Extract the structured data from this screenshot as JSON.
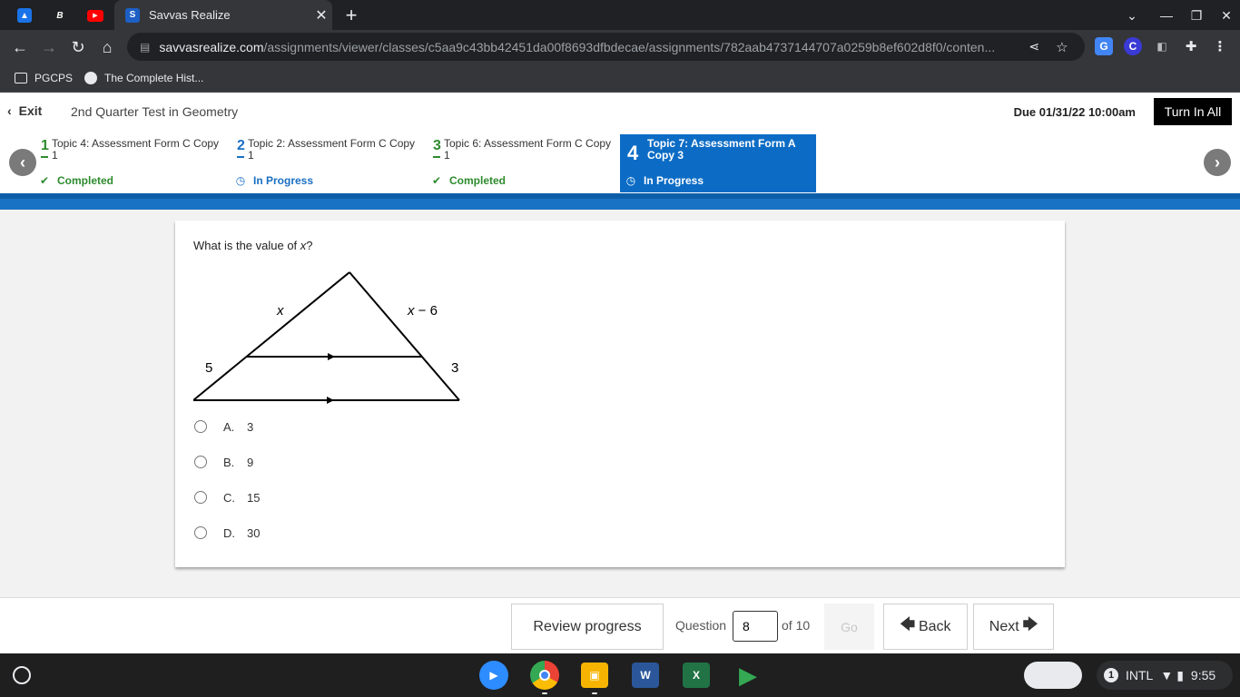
{
  "browser": {
    "tab_title": "Savvas Realize",
    "url_host": "savvasrealize.com",
    "url_path": "/assignments/viewer/classes/c5aa9c43bb42451da00f8693dfbdecae/assignments/782aab4737144707a0259b8ef602d8f0/conten...",
    "bookmarks": [
      "PGCPS",
      "The Complete Hist..."
    ]
  },
  "header": {
    "exit_label": "Exit",
    "test_title": "2nd Quarter Test in Geometry",
    "due": "Due 01/31/22 10:00am",
    "turn_in": "Turn In All"
  },
  "topics": [
    {
      "num": "1",
      "name": "Topic 4: Assessment Form C Copy 1",
      "status": "Completed"
    },
    {
      "num": "2",
      "name": "Topic 2: Assessment Form C Copy 1",
      "status": "In Progress"
    },
    {
      "num": "3",
      "name": "Topic 6: Assessment Form C Copy 1",
      "status": "Completed"
    },
    {
      "num": "4",
      "name": "Topic 7: Assessment Form A Copy 3",
      "status": "In Progress"
    }
  ],
  "question": {
    "prompt_prefix": "What is the value of ",
    "prompt_var": "x",
    "prompt_suffix": "?",
    "diagram_labels": {
      "left_top": "x",
      "right_top_var": "x",
      "right_top_rest": " − 6",
      "left_bottom": "5",
      "right_bottom": "3"
    },
    "choices": [
      {
        "letter": "A.",
        "value": "3"
      },
      {
        "letter": "B.",
        "value": "9"
      },
      {
        "letter": "C.",
        "value": "15"
      },
      {
        "letter": "D.",
        "value": "30"
      }
    ]
  },
  "footer": {
    "review": "Review progress",
    "question_label": "Question",
    "question_value": "8",
    "of_total": "of 10",
    "go": "Go",
    "back": "Back",
    "next": "Next"
  },
  "shelf": {
    "tray_badge": "1",
    "tray_input": "INTL",
    "time": "9:55"
  }
}
